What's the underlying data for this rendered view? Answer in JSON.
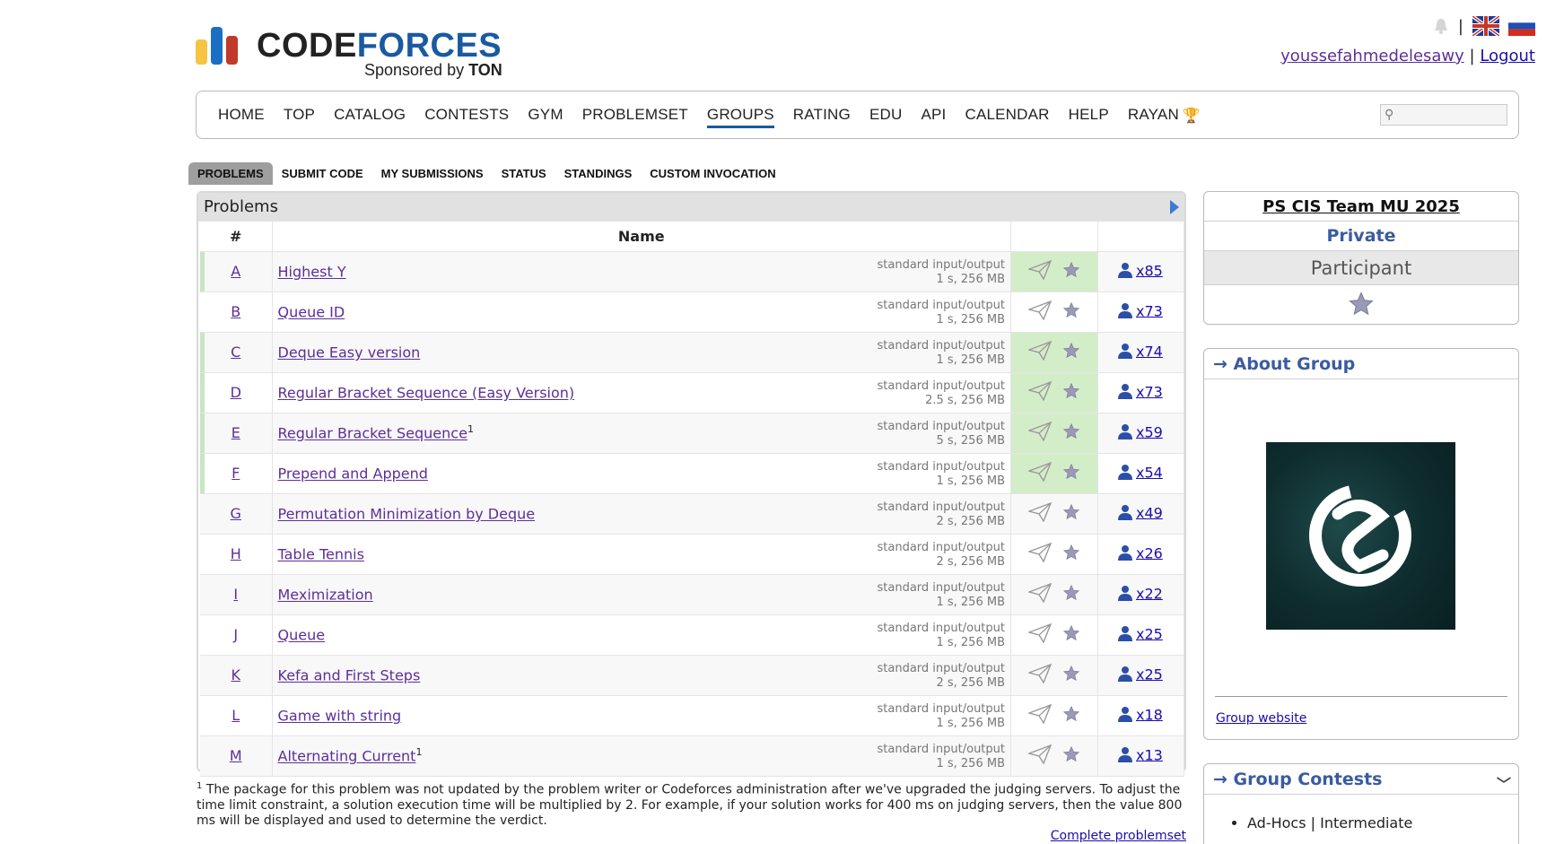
{
  "header": {
    "brand": "CODEFORCES",
    "sponsor_prefix": "Sponsored by",
    "sponsor_name": "TON",
    "username": "youssefahmedelesawy",
    "separator": "|",
    "logout": "Logout"
  },
  "nav": {
    "items": [
      "HOME",
      "TOP",
      "CATALOG",
      "CONTESTS",
      "GYM",
      "PROBLEMSET",
      "GROUPS",
      "RATING",
      "EDU",
      "API",
      "CALENDAR",
      "HELP",
      "RAYAN"
    ],
    "active": "GROUPS",
    "search_placeholder": ""
  },
  "tabs": {
    "items": [
      "PROBLEMS",
      "SUBMIT CODE",
      "MY SUBMISSIONS",
      "STATUS",
      "STANDINGS",
      "CUSTOM INVOCATION"
    ],
    "active": "PROBLEMS"
  },
  "problems": {
    "title": "Problems",
    "col_index": "#",
    "col_name": "Name",
    "rows": [
      {
        "idx": "A",
        "name": "Highest Y",
        "sup": "",
        "io": "standard input/output",
        "limits": "1 s, 256 MB",
        "count": "x85",
        "solved": true
      },
      {
        "idx": "B",
        "name": "Queue ID",
        "sup": "",
        "io": "standard input/output",
        "limits": "1 s, 256 MB",
        "count": "x73",
        "solved": false
      },
      {
        "idx": "C",
        "name": "Deque Easy version",
        "sup": "",
        "io": "standard input/output",
        "limits": "1 s, 256 MB",
        "count": "x74",
        "solved": true
      },
      {
        "idx": "D",
        "name": "Regular Bracket Sequence (Easy Version)",
        "sup": "",
        "io": "standard input/output",
        "limits": "2.5 s, 256 MB",
        "count": "x73",
        "solved": true
      },
      {
        "idx": "E",
        "name": "Regular Bracket Sequence",
        "sup": "1",
        "io": "standard input/output",
        "limits": "5 s, 256 MB",
        "count": "x59",
        "solved": true
      },
      {
        "idx": "F",
        "name": "Prepend and Append",
        "sup": "",
        "io": "standard input/output",
        "limits": "1 s, 256 MB",
        "count": "x54",
        "solved": true
      },
      {
        "idx": "G",
        "name": "Permutation Minimization by Deque",
        "sup": "",
        "io": "standard input/output",
        "limits": "2 s, 256 MB",
        "count": "x49",
        "solved": false
      },
      {
        "idx": "H",
        "name": "Table Tennis",
        "sup": "",
        "io": "standard input/output",
        "limits": "2 s, 256 MB",
        "count": "x26",
        "solved": false
      },
      {
        "idx": "I",
        "name": "Meximization",
        "sup": "",
        "io": "standard input/output",
        "limits": "1 s, 256 MB",
        "count": "x22",
        "solved": false
      },
      {
        "idx": "J",
        "name": "Queue",
        "sup": "",
        "io": "standard input/output",
        "limits": "1 s, 256 MB",
        "count": "x25",
        "solved": false
      },
      {
        "idx": "K",
        "name": "Kefa and First Steps",
        "sup": "",
        "io": "standard input/output",
        "limits": "2 s, 256 MB",
        "count": "x25",
        "solved": false
      },
      {
        "idx": "L",
        "name": "Game with string",
        "sup": "",
        "io": "standard input/output",
        "limits": "1 s, 256 MB",
        "count": "x18",
        "solved": false
      },
      {
        "idx": "M",
        "name": "Alternating Current",
        "sup": "1",
        "io": "standard input/output",
        "limits": "1 s, 256 MB",
        "count": "x13",
        "solved": false
      }
    ]
  },
  "footnote": {
    "mark": "1",
    "text": "The package for this problem was not updated by the problem writer or Codeforces administration after we've upgraded the judging servers. To adjust the time limit constraint, a solution execution time will be multiplied by 2. For example, if your solution works for 400 ms on judging servers, then the value 800 ms will be displayed and used to determine the verdict."
  },
  "complete_problemset": "Complete problemset",
  "sidebar": {
    "group_name": "PS CIS Team MU 2025",
    "visibility": "Private",
    "role": "Participant",
    "about_title": "→ About Group",
    "group_website": "Group website",
    "contests_title": "→ Group Contests",
    "contests": [
      "Ad-Hocs | Intermediate"
    ]
  },
  "colors": {
    "solved_bg": "#d4edc9",
    "link": "#1a0dab",
    "visited": "#5c2f99",
    "sidebar_title": "#3a5ba0"
  }
}
